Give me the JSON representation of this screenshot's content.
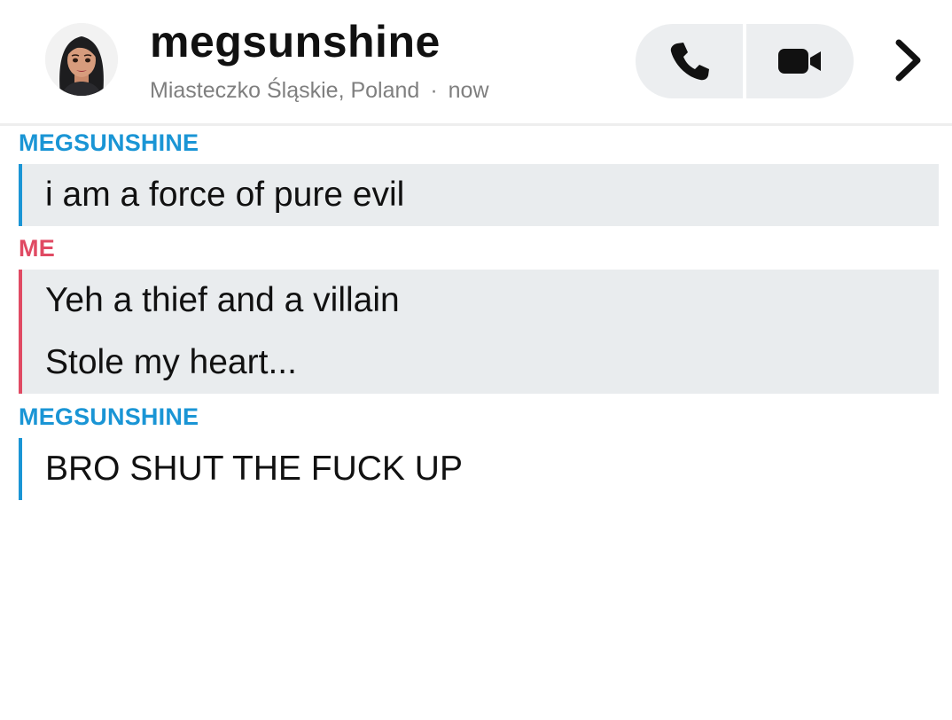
{
  "header": {
    "contact_name": "megsunshine",
    "location": "Miasteczko Śląskie, Poland",
    "separator": "·",
    "time": "now"
  },
  "icons": {
    "avatar": "bitmoji-avatar",
    "phone": "phone-icon",
    "video": "video-camera-icon",
    "chevron": "chevron-right-icon"
  },
  "colors": {
    "them": "#1a95d5",
    "me": "#e04a63",
    "bubble_bg": "#e9ecee",
    "call_bg": "#eceef0"
  },
  "messages": [
    {
      "sender": "MEGSUNSHINE",
      "lines": [
        "i am a force of pure evil"
      ]
    },
    {
      "sender": "ME",
      "lines": [
        "Yeh a thief and a villain",
        "Stole my heart..."
      ]
    },
    {
      "sender": "MEGSUNSHINE",
      "lines": [
        "BRO SHUT THE FUCK UP"
      ]
    }
  ]
}
